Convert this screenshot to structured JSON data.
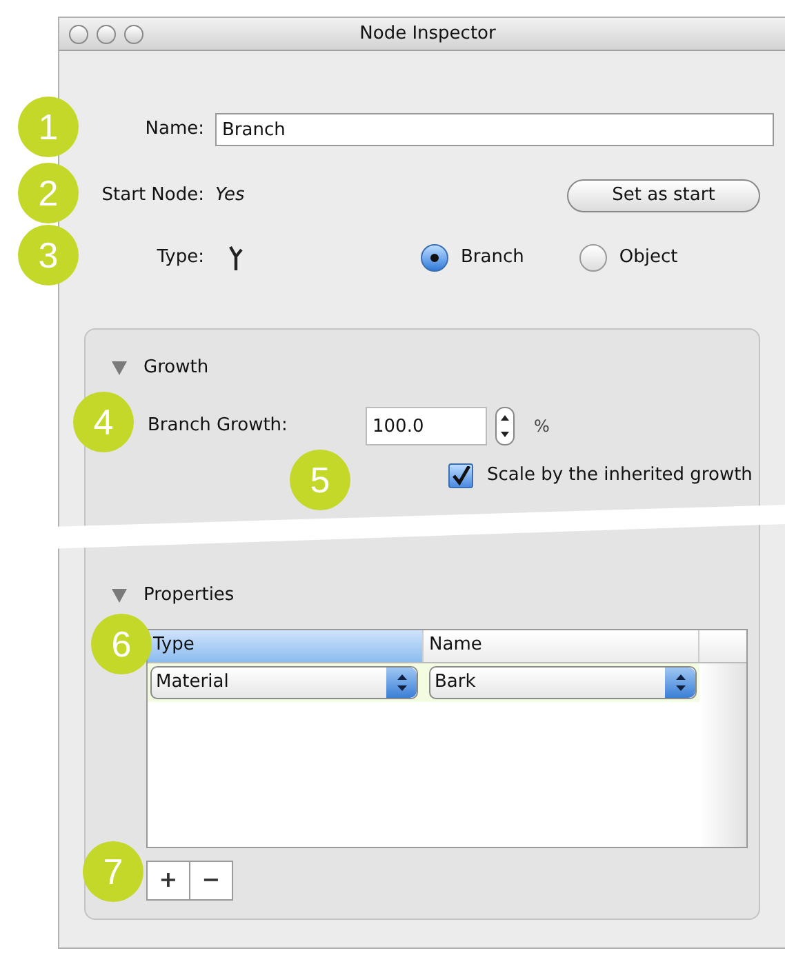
{
  "window": {
    "title": "Node Inspector"
  },
  "name_field": {
    "label": "Name:",
    "value": "Branch"
  },
  "start_node": {
    "label": "Start Node:",
    "value": "Yes",
    "button": "Set as start"
  },
  "type": {
    "label": "Type:",
    "options": [
      {
        "label": "Branch",
        "selected": true
      },
      {
        "label": "Object",
        "selected": false
      }
    ]
  },
  "growth": {
    "title": "Growth",
    "expanded": true,
    "field_label": "Branch Growth:",
    "value": "100.0",
    "unit": "%",
    "checkbox": {
      "label": "Scale by the inherited growth",
      "checked": true
    }
  },
  "properties": {
    "title": "Properties",
    "expanded": true,
    "columns": [
      {
        "label": "Type",
        "selected": true
      },
      {
        "label": "Name",
        "selected": false
      }
    ],
    "rows": [
      [
        "Material",
        "Bark"
      ]
    ],
    "buttons": [
      "+",
      "−"
    ]
  },
  "callouts": [
    "1",
    "2",
    "3",
    "4",
    "5",
    "6",
    "7"
  ]
}
